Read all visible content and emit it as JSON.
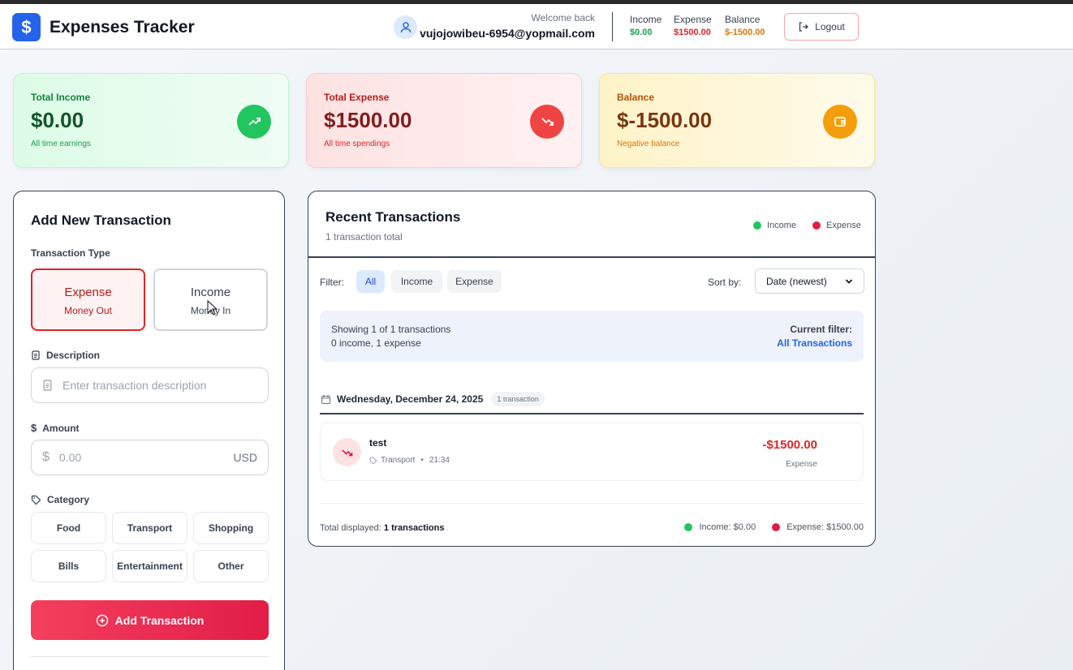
{
  "colors": {
    "accent": "#2563eb",
    "income": "#16a34a",
    "expense": "#dc2626",
    "balance": "#d97706"
  },
  "header": {
    "brand_icon": "dollar-icon",
    "title": "Expenses Tracker",
    "welcome": "Welcome back",
    "email": "vujojowibeu-6954@yopmail.com",
    "stats": [
      {
        "label": "Income",
        "value": "$0.00"
      },
      {
        "label": "Expense",
        "value": "$1500.00"
      },
      {
        "label": "Balance",
        "value": "$-1500.00"
      }
    ],
    "logout_label": "Logout"
  },
  "cards": {
    "income": {
      "label": "Total Income",
      "value": "$0.00",
      "sub": "All time earnings",
      "icon": "trending-up-icon"
    },
    "expense": {
      "label": "Total Expense",
      "value": "$1500.00",
      "sub": "All time spendings",
      "icon": "trending-down-icon"
    },
    "balance": {
      "label": "Balance",
      "value": "$-1500.00",
      "sub": "Negative balance",
      "icon": "wallet-icon"
    }
  },
  "form": {
    "title": "Add New Transaction",
    "type_label": "Transaction Type",
    "expense": {
      "title": "Expense",
      "sub": "Money Out"
    },
    "income": {
      "title": "Income",
      "sub": "Money In"
    },
    "description_label": "Description",
    "description_placeholder": "Enter transaction description",
    "amount_label": "Amount",
    "amount_placeholder": "0.00",
    "currency_symbol": "$",
    "currency": "USD",
    "category_label": "Category",
    "categories": [
      "Food",
      "Transport",
      "Shopping",
      "Bills",
      "Entertainment",
      "Other"
    ],
    "submit_label": "Add Transaction"
  },
  "transactions": {
    "title": "Recent Transactions",
    "subtitle": "1 transaction total",
    "legend": [
      "Income",
      "Expense"
    ],
    "filter_label": "Filter:",
    "filters": [
      "All",
      "Income",
      "Expense"
    ],
    "active_filter": "All",
    "sort_label": "Sort by:",
    "sort_value": "Date (newest)",
    "info": {
      "showing": "Showing 1 of 1 transactions",
      "breakdown": "0 income, 1 expense",
      "current_filter_label": "Current filter:",
      "current_filter_value": "All Transactions"
    },
    "groups": [
      {
        "date": "Wednesday, December 24, 2025",
        "count": "1 transaction",
        "items": [
          {
            "name": "test",
            "category": "Transport",
            "time": "21:34",
            "amount": "-$1500.00",
            "kind": "Expense"
          }
        ]
      }
    ],
    "footer": {
      "total_label": "Total displayed:",
      "total_value": "1 transactions",
      "income_total": "Income: $0.00",
      "expense_total": "Expense: $1500.00"
    }
  }
}
